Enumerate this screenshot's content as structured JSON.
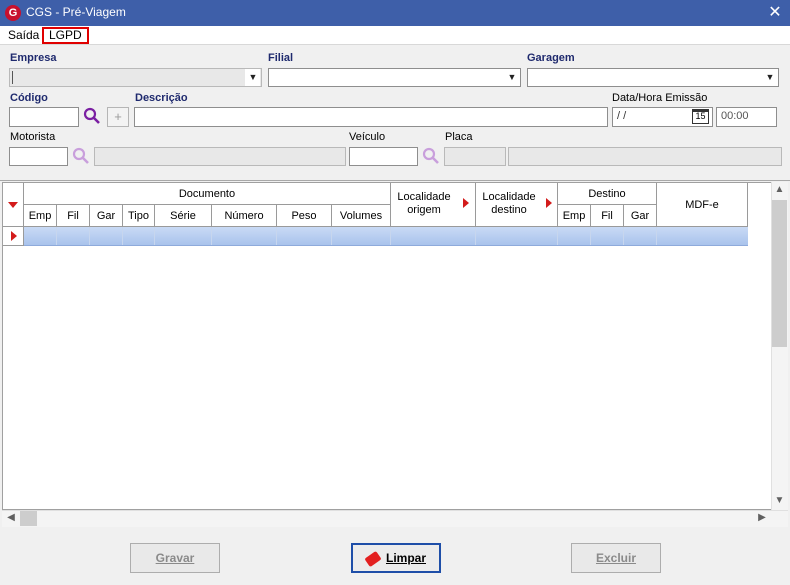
{
  "window": {
    "title": "CGS - Pré-Viagem",
    "logo_letter": "G",
    "close_glyph": "✕"
  },
  "menu": {
    "saida": "Saída",
    "lgpd": "LGPD"
  },
  "form": {
    "empresa_label": "Empresa",
    "filial_label": "Filial",
    "garagem_label": "Garagem",
    "codigo_label": "Código",
    "descricao_label": "Descrição",
    "data_hora_label": "Data/Hora Emissão",
    "date_value": " / /",
    "time_value": "00:00",
    "calendar_day": "15",
    "motorista_label": "Motorista",
    "veiculo_label": "Veículo",
    "placa_label": "Placa",
    "plus_glyph": "+"
  },
  "grid": {
    "groups": {
      "documento": "Documento",
      "localidade_origem": "Localidade origem",
      "localidade_destino": "Localidade destino",
      "destino": "Destino",
      "mdfe": "MDF-e"
    },
    "columns": {
      "emp": "Emp",
      "fil": "Fil",
      "gar": "Gar",
      "tipo": "Tipo",
      "serie": "Série",
      "numero": "Número",
      "peso": "Peso",
      "volumes": "Volumes",
      "d_emp": "Emp",
      "d_fil": "Fil",
      "d_gar": "Gar"
    }
  },
  "buttons": {
    "gravar": "Gravar",
    "limpar": "Limpar",
    "excluir": "Excluir"
  },
  "colors": {
    "titlebar": "#3e5fa9",
    "row_selected": "#b7cdf2",
    "marker": "#d31b1b",
    "label_bold": "#1f2a6e"
  }
}
